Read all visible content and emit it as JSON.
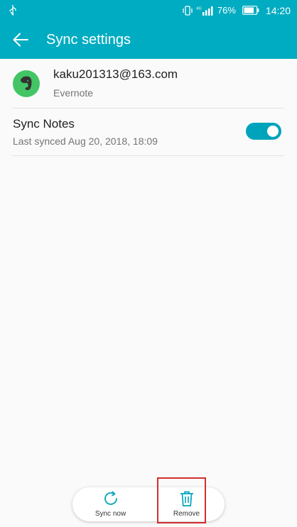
{
  "status_bar": {
    "icons": [
      "usb-icon",
      "vibrate-icon",
      "network-4g-icon",
      "battery-icon"
    ],
    "network": "4G",
    "battery": "76%",
    "time": "14:20"
  },
  "app_bar": {
    "back_icon": "arrow-back-icon",
    "title": "Sync settings"
  },
  "account": {
    "email": "kaku201313@163.com",
    "type": "Evernote",
    "icon": "evernote-elephant-icon"
  },
  "sync_notes": {
    "label": "Sync Notes",
    "last_synced": "Last synced Aug 20, 2018, 18:09",
    "enabled": true
  },
  "actions": {
    "sync_now": {
      "label": "Sync now",
      "icon": "refresh-icon"
    },
    "remove": {
      "label": "Remove",
      "icon": "trash-icon"
    }
  },
  "colors": {
    "accent": "#00acc1",
    "toggle": "#00a3bc",
    "evernote": "#43c565",
    "highlight": "#d32f2f"
  }
}
